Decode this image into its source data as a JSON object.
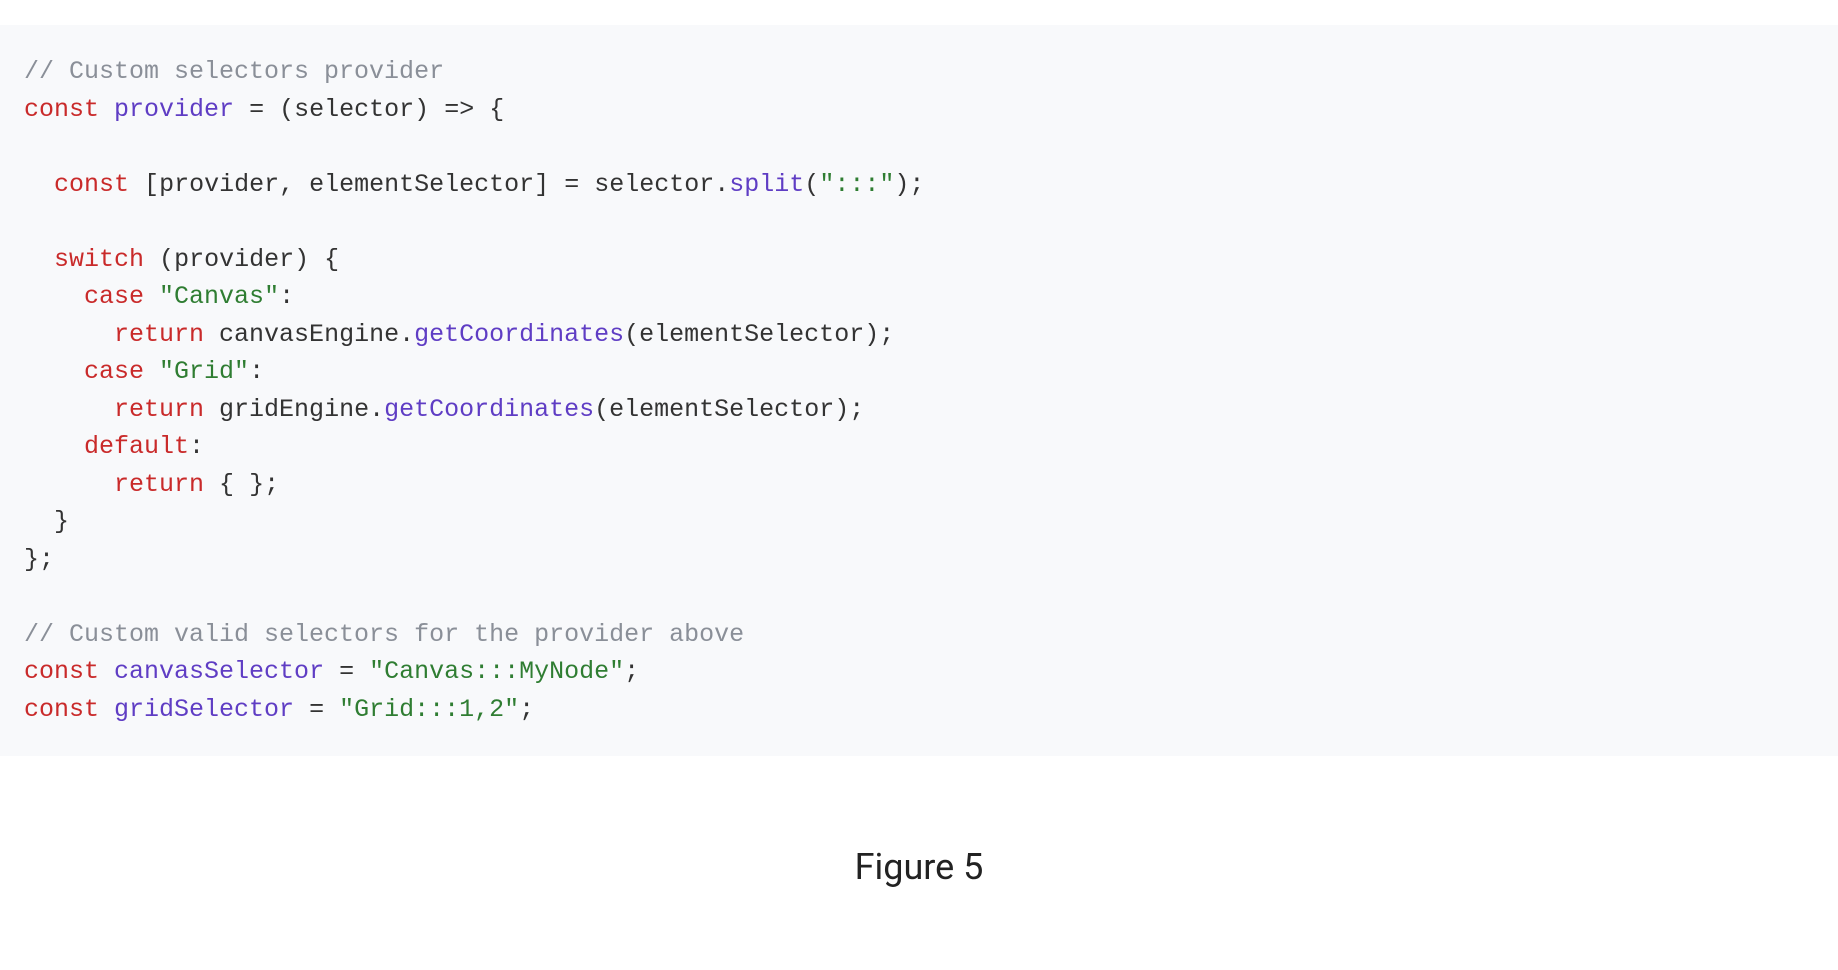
{
  "code": {
    "lines": [
      {
        "indent": 0,
        "type": "comment",
        "text": "// Custom selectors provider"
      },
      {
        "indent": 0,
        "type": "tokens",
        "tokens": [
          {
            "c": "keyword",
            "t": "const"
          },
          {
            "c": "punct",
            "t": " "
          },
          {
            "c": "decl",
            "t": "provider"
          },
          {
            "c": "punct",
            "t": " "
          },
          {
            "c": "punct",
            "t": "="
          },
          {
            "c": "punct",
            "t": " "
          },
          {
            "c": "punct",
            "t": "("
          },
          {
            "c": "ident",
            "t": "selector"
          },
          {
            "c": "punct",
            "t": ")"
          },
          {
            "c": "punct",
            "t": " "
          },
          {
            "c": "arrow",
            "t": "=>"
          },
          {
            "c": "punct",
            "t": " "
          },
          {
            "c": "punct",
            "t": "{"
          }
        ]
      },
      {
        "indent": 0,
        "type": "blank",
        "text": ""
      },
      {
        "indent": 1,
        "type": "tokens",
        "tokens": [
          {
            "c": "keyword",
            "t": "const"
          },
          {
            "c": "punct",
            "t": " "
          },
          {
            "c": "punct",
            "t": "["
          },
          {
            "c": "ident",
            "t": "provider"
          },
          {
            "c": "punct",
            "t": ","
          },
          {
            "c": "punct",
            "t": " "
          },
          {
            "c": "ident",
            "t": "elementSelector"
          },
          {
            "c": "punct",
            "t": "]"
          },
          {
            "c": "punct",
            "t": " "
          },
          {
            "c": "punct",
            "t": "="
          },
          {
            "c": "punct",
            "t": " "
          },
          {
            "c": "ident",
            "t": "selector"
          },
          {
            "c": "punct",
            "t": "."
          },
          {
            "c": "method",
            "t": "split"
          },
          {
            "c": "punct",
            "t": "("
          },
          {
            "c": "string",
            "t": "\":::\""
          },
          {
            "c": "punct",
            "t": ")"
          },
          {
            "c": "punct",
            "t": ";"
          }
        ]
      },
      {
        "indent": 0,
        "type": "blank",
        "text": ""
      },
      {
        "indent": 1,
        "type": "tokens",
        "tokens": [
          {
            "c": "keyword",
            "t": "switch"
          },
          {
            "c": "punct",
            "t": " "
          },
          {
            "c": "punct",
            "t": "("
          },
          {
            "c": "ident",
            "t": "provider"
          },
          {
            "c": "punct",
            "t": ")"
          },
          {
            "c": "punct",
            "t": " "
          },
          {
            "c": "punct",
            "t": "{"
          }
        ]
      },
      {
        "indent": 2,
        "type": "tokens",
        "tokens": [
          {
            "c": "keyword",
            "t": "case"
          },
          {
            "c": "punct",
            "t": " "
          },
          {
            "c": "string",
            "t": "\"Canvas\""
          },
          {
            "c": "punct",
            "t": ":"
          }
        ]
      },
      {
        "indent": 3,
        "type": "tokens",
        "tokens": [
          {
            "c": "keyword",
            "t": "return"
          },
          {
            "c": "punct",
            "t": " "
          },
          {
            "c": "ident",
            "t": "canvasEngine"
          },
          {
            "c": "punct",
            "t": "."
          },
          {
            "c": "method",
            "t": "getCoordinates"
          },
          {
            "c": "punct",
            "t": "("
          },
          {
            "c": "ident",
            "t": "elementSelector"
          },
          {
            "c": "punct",
            "t": ")"
          },
          {
            "c": "punct",
            "t": ";"
          }
        ]
      },
      {
        "indent": 2,
        "type": "tokens",
        "tokens": [
          {
            "c": "keyword",
            "t": "case"
          },
          {
            "c": "punct",
            "t": " "
          },
          {
            "c": "string",
            "t": "\"Grid\""
          },
          {
            "c": "punct",
            "t": ":"
          }
        ]
      },
      {
        "indent": 3,
        "type": "tokens",
        "tokens": [
          {
            "c": "keyword",
            "t": "return"
          },
          {
            "c": "punct",
            "t": " "
          },
          {
            "c": "ident",
            "t": "gridEngine"
          },
          {
            "c": "punct",
            "t": "."
          },
          {
            "c": "method",
            "t": "getCoordinates"
          },
          {
            "c": "punct",
            "t": "("
          },
          {
            "c": "ident",
            "t": "elementSelector"
          },
          {
            "c": "punct",
            "t": ")"
          },
          {
            "c": "punct",
            "t": ";"
          }
        ]
      },
      {
        "indent": 2,
        "type": "tokens",
        "tokens": [
          {
            "c": "keyword",
            "t": "default"
          },
          {
            "c": "punct",
            "t": ":"
          }
        ]
      },
      {
        "indent": 3,
        "type": "tokens",
        "tokens": [
          {
            "c": "keyword",
            "t": "return"
          },
          {
            "c": "punct",
            "t": " "
          },
          {
            "c": "punct",
            "t": "{"
          },
          {
            "c": "punct",
            "t": " "
          },
          {
            "c": "punct",
            "t": "}"
          },
          {
            "c": "punct",
            "t": ";"
          }
        ]
      },
      {
        "indent": 1,
        "type": "tokens",
        "tokens": [
          {
            "c": "punct",
            "t": "}"
          }
        ]
      },
      {
        "indent": 0,
        "type": "tokens",
        "tokens": [
          {
            "c": "punct",
            "t": "}"
          },
          {
            "c": "punct",
            "t": ";"
          }
        ]
      },
      {
        "indent": 0,
        "type": "blank",
        "text": ""
      },
      {
        "indent": 0,
        "type": "comment",
        "text": "// Custom valid selectors for the provider above"
      },
      {
        "indent": 0,
        "type": "tokens",
        "tokens": [
          {
            "c": "keyword",
            "t": "const"
          },
          {
            "c": "punct",
            "t": " "
          },
          {
            "c": "decl",
            "t": "canvasSelector"
          },
          {
            "c": "punct",
            "t": " "
          },
          {
            "c": "punct",
            "t": "="
          },
          {
            "c": "punct",
            "t": " "
          },
          {
            "c": "string",
            "t": "\"Canvas:::MyNode\""
          },
          {
            "c": "punct",
            "t": ";"
          }
        ]
      },
      {
        "indent": 0,
        "type": "tokens",
        "tokens": [
          {
            "c": "keyword",
            "t": "const"
          },
          {
            "c": "punct",
            "t": " "
          },
          {
            "c": "decl",
            "t": "gridSelector"
          },
          {
            "c": "punct",
            "t": " "
          },
          {
            "c": "punct",
            "t": "="
          },
          {
            "c": "punct",
            "t": " "
          },
          {
            "c": "string",
            "t": "\"Grid:::1,2\""
          },
          {
            "c": "punct",
            "t": ";"
          }
        ]
      }
    ]
  },
  "caption": "Figure 5"
}
